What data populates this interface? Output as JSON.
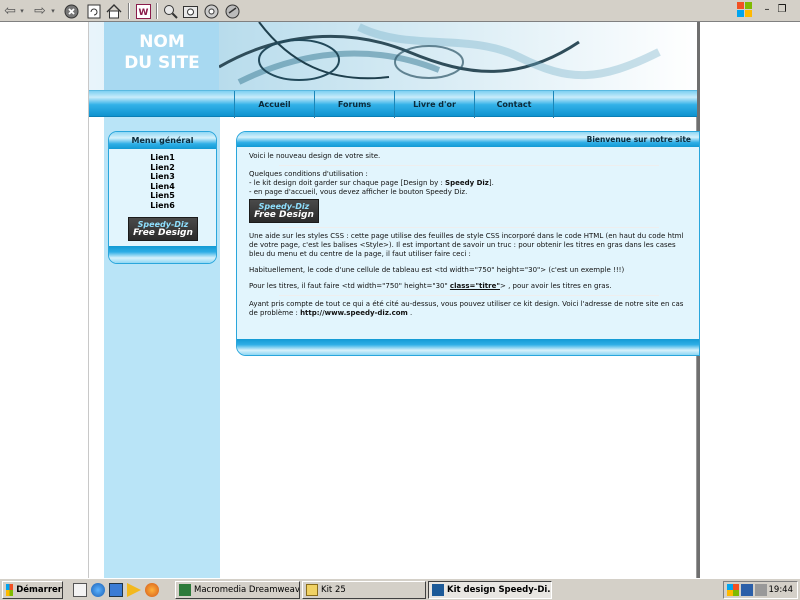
{
  "browser": {
    "toolbar_icons": [
      "back-arrow-icon",
      "forward-arrow-icon",
      "stop-icon",
      "refresh-icon",
      "home-icon",
      "media-icon",
      "search-icon",
      "history-icon",
      "print-icon",
      "mail-icon"
    ],
    "window_controls": [
      "minimize",
      "restore"
    ]
  },
  "site": {
    "name_line1": "NOM",
    "name_line2": "DU SITE",
    "nav": [
      "Accueil",
      "Forums",
      "Livre d'or",
      "Contact"
    ]
  },
  "menu": {
    "title": "Menu général",
    "links": [
      "Lien1",
      "Lien2",
      "Lien3",
      "Lien4",
      "Lien5",
      "Lien6"
    ],
    "badge_line1": "Speedy-Diz",
    "badge_line2": "Free Design"
  },
  "content": {
    "title": "Bienvenue sur notre site",
    "intro": "Voici le nouveau design de votre site.",
    "conditions_title": "Quelques conditions d'utilisation :",
    "condition1_prefix": "- le kit design doit garder sur chaque page [Design by : ",
    "condition1_bold": "Speedy Diz",
    "condition1_suffix": "].",
    "condition2": "- en page d'accueil, vous devez afficher le bouton Speedy Diz.",
    "css_help": "Une aide sur les styles CSS : cette page utilise des feuilles de style CSS incorporé dans le code HTML (en haut du code html de votre page, c'est les balises <Style>). Il est important de savoir un truc : pour obtenir les titres en gras dans les cases bleu du menu et du centre de la page, il faut utiliser faire ceci :",
    "table_code": "Habituellement, le code d'une cellule de tableau est <td width=\"750\" height=\"30\"> (c'est un exemple !!!)",
    "titles_prefix": "Pour les titres, il faut faire <td width=\"750\" height=\"30\" ",
    "titles_code": "class=\"titre\"",
    "titles_suffix": "> , pour avoir les titres en gras.",
    "closing_text": "Ayant pris compte de tout ce qui a été cité au-dessus, vous pouvez utiliser ce kit design. Voici l'adresse de notre site en cas de problème : ",
    "closing_url": "http://www.speedy-diz.com",
    "closing_end": " ."
  },
  "taskbar": {
    "start_label": "Démarrer",
    "tasks": [
      {
        "label": "Macromedia Dreamweaver...",
        "active": false
      },
      {
        "label": "Kit 25",
        "active": false
      },
      {
        "label": "Kit design Speedy-Di...",
        "active": true
      }
    ],
    "clock": "19:44"
  },
  "colors": {
    "accent_blue": "#2eaee6",
    "light_blue": "#b9e4f7",
    "box_bg": "#e2f5fd"
  }
}
